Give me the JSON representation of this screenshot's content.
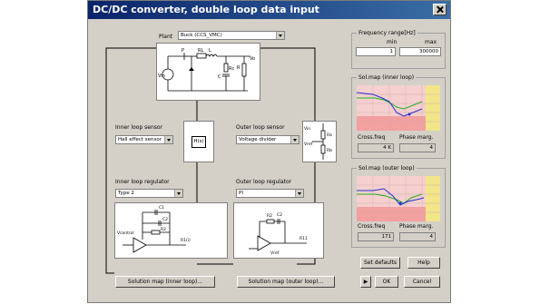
{
  "window": {
    "title": "DC/DC converter, double loop data input"
  },
  "plant": {
    "label": "Plant",
    "value": "Buck (CCS_VMC)"
  },
  "circuit": {
    "vin": "Vin",
    "p": "P",
    "rl": "RL",
    "c": "C",
    "rc": "Rc",
    "r": "R",
    "l": "L",
    "vo": "Vo"
  },
  "inner_sensor": {
    "label": "Inner loop sensor",
    "value": "Hall effect sensor"
  },
  "outer_sensor": {
    "label": "Outer loop sensor",
    "value": "Voltage divider"
  },
  "sensor_block": {
    "hs": "H(s)",
    "ra": "Ra",
    "rb": "Rb",
    "vin": "Vin",
    "vref": "Vref"
  },
  "inner_regulator": {
    "label": "Inner loop regulator",
    "value": "Type 2",
    "c1": "C1",
    "c2": "C2",
    "r2": "R2",
    "r1": "R1(i)",
    "vctrl": "Vcontrol"
  },
  "outer_regulator": {
    "label": "Outer loop regulator",
    "value": "PI",
    "r2": "R2",
    "c2": "C2",
    "r1": "R11",
    "vref": "Vref"
  },
  "freq": {
    "title": "Frequency range[Hz]",
    "min_label": "min",
    "max_label": "max",
    "min": "1",
    "max": "300000"
  },
  "inner_map": {
    "title": "Sol.map (inner loop)",
    "cross_label": "Cross.freq",
    "phase_label": "Phase marg.",
    "cross": "4 K",
    "phase": "4"
  },
  "outer_map": {
    "title": "Sol.map (outer loop)",
    "cross_label": "Cross.freq",
    "phase_label": "Phase marg.",
    "cross": "171",
    "phase": "4"
  },
  "buttons": {
    "set_defaults": "Set defaults",
    "help": "Help",
    "ok": "OK",
    "cancel": "Cancel",
    "sol_inner": "Solution map (inner loop)...",
    "sol_outer": "Solution map (outer loop)...",
    "play": "▶"
  },
  "colors": {
    "titlebar": "#0a246a",
    "map_red": "#f3a0a0",
    "map_pink": "#f6cfcf",
    "map_yellow": "#f2e58a",
    "curve_blue": "#2030d0",
    "curve_green": "#20b020"
  }
}
